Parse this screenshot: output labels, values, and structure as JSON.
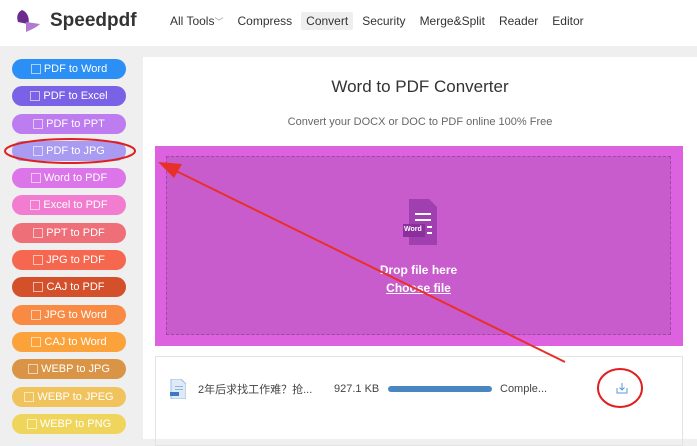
{
  "header": {
    "brand": "Speedpdf",
    "nav": [
      "All Tools",
      "Compress",
      "Convert",
      "Security",
      "Merge&Split",
      "Reader",
      "Editor"
    ],
    "active": "Convert"
  },
  "sidebar": {
    "items": [
      {
        "label": "PDF to Word",
        "color": "#2b8ff5"
      },
      {
        "label": "PDF to Excel",
        "color": "#7a62e6"
      },
      {
        "label": "PDF to PPT",
        "color": "#bd7cf0"
      },
      {
        "label": "PDF to JPG",
        "color": "#a99af2"
      },
      {
        "label": "Word to PDF",
        "color": "#dc74ea"
      },
      {
        "label": "Excel to PDF",
        "color": "#f27cd0"
      },
      {
        "label": "PPT to PDF",
        "color": "#ef6f78"
      },
      {
        "label": "JPG to PDF",
        "color": "#f6674f"
      },
      {
        "label": "CAJ to PDF",
        "color": "#d4502a"
      },
      {
        "label": "JPG to Word",
        "color": "#f88a44"
      },
      {
        "label": "CAJ to Word",
        "color": "#fca23a"
      },
      {
        "label": "WEBP to JPG",
        "color": "#d99446"
      },
      {
        "label": "WEBP to JPEG",
        "color": "#f1c35c"
      },
      {
        "label": "WEBP to PNG",
        "color": "#efd55c"
      }
    ]
  },
  "main": {
    "title": "Word to PDF Converter",
    "subtitle": "Convert your DOCX or DOC to PDF online 100% Free",
    "icon_label": "Word",
    "drop_text": "Drop file here",
    "choose": "Choose file"
  },
  "file": {
    "name": "2年后求找工作难？抢...",
    "size": "927.1 KB",
    "progress": 100,
    "status": "Comple..."
  }
}
